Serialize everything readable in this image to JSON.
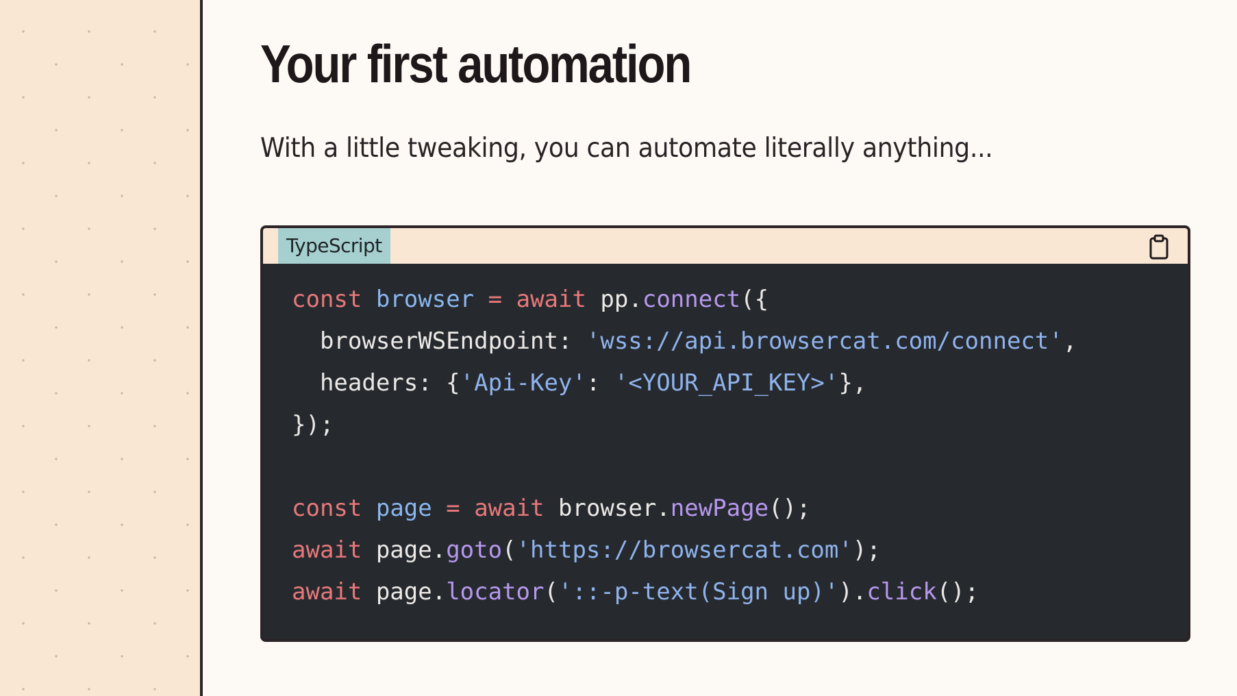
{
  "page": {
    "title": "Your first automation",
    "subtitle": "With a little tweaking, you can automate literally anything..."
  },
  "code_block": {
    "language_label": "TypeScript",
    "copy_icon": "clipboard-icon",
    "colors": {
      "background": "#262a2f",
      "keyword": "#e9787a",
      "variable": "#8ab6ee",
      "function": "#b798ee",
      "string": "#8fb3ec",
      "plain": "#ece9e6",
      "language_tab": "#a6cfcf"
    },
    "lines": [
      [
        {
          "t": "const",
          "c": "kw"
        },
        {
          "t": " ",
          "c": "plain"
        },
        {
          "t": "browser",
          "c": "var"
        },
        {
          "t": " ",
          "c": "plain"
        },
        {
          "t": "=",
          "c": "op"
        },
        {
          "t": " ",
          "c": "plain"
        },
        {
          "t": "await",
          "c": "kw"
        },
        {
          "t": " pp.",
          "c": "plain"
        },
        {
          "t": "connect",
          "c": "fn"
        },
        {
          "t": "({",
          "c": "plain"
        }
      ],
      [
        {
          "t": "  browserWSEndpoint: ",
          "c": "plain"
        },
        {
          "t": "'wss://api.browsercat.com/connect'",
          "c": "str"
        },
        {
          "t": ",",
          "c": "plain"
        }
      ],
      [
        {
          "t": "  headers: {",
          "c": "plain"
        },
        {
          "t": "'Api-Key'",
          "c": "str"
        },
        {
          "t": ": ",
          "c": "plain"
        },
        {
          "t": "'<YOUR_API_KEY>'",
          "c": "str"
        },
        {
          "t": "},",
          "c": "plain"
        }
      ],
      [
        {
          "t": "});",
          "c": "plain"
        }
      ],
      [],
      [
        {
          "t": "const",
          "c": "kw"
        },
        {
          "t": " ",
          "c": "plain"
        },
        {
          "t": "page",
          "c": "var"
        },
        {
          "t": " ",
          "c": "plain"
        },
        {
          "t": "=",
          "c": "op"
        },
        {
          "t": " ",
          "c": "plain"
        },
        {
          "t": "await",
          "c": "kw"
        },
        {
          "t": " browser.",
          "c": "plain"
        },
        {
          "t": "newPage",
          "c": "fn"
        },
        {
          "t": "();",
          "c": "plain"
        }
      ],
      [
        {
          "t": "await",
          "c": "kw"
        },
        {
          "t": " page.",
          "c": "plain"
        },
        {
          "t": "goto",
          "c": "fn"
        },
        {
          "t": "(",
          "c": "plain"
        },
        {
          "t": "'https://browsercat.com'",
          "c": "str"
        },
        {
          "t": ");",
          "c": "plain"
        }
      ],
      [
        {
          "t": "await",
          "c": "kw"
        },
        {
          "t": " page.",
          "c": "plain"
        },
        {
          "t": "locator",
          "c": "fn"
        },
        {
          "t": "(",
          "c": "plain"
        },
        {
          "t": "'::-p-text(Sign up)'",
          "c": "str"
        },
        {
          "t": ").",
          "c": "plain"
        },
        {
          "t": "click",
          "c": "fn"
        },
        {
          "t": "();",
          "c": "plain"
        }
      ]
    ]
  }
}
